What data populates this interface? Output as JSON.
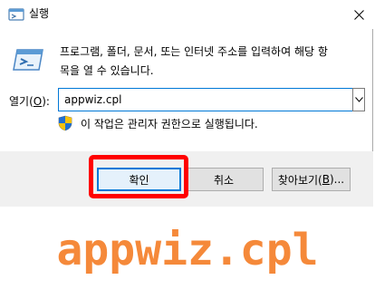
{
  "window": {
    "title": "실행",
    "close_icon": "close-icon"
  },
  "dialog": {
    "description_line1": "프로그램, 폴더, 문서, 또는 인터넷 주소를 입력하여 해당 항",
    "description_line2": "목을 열 수 있습니다.",
    "open_label_prefix": "열기(",
    "open_label_accel": "O",
    "open_label_suffix": "):",
    "open_value": "appwiz.cpl",
    "admin_note": "이 작업은 관리자 권한으로 실행됩니다."
  },
  "buttons": {
    "ok": "확인",
    "cancel": "취소",
    "browse_prefix": "찾아보기(",
    "browse_accel": "B",
    "browse_suffix": ")..."
  },
  "caption": "appwiz.cpl",
  "colors": {
    "highlight": "#ff0000",
    "caption": "#f5893a",
    "accent": "#0078d7"
  }
}
